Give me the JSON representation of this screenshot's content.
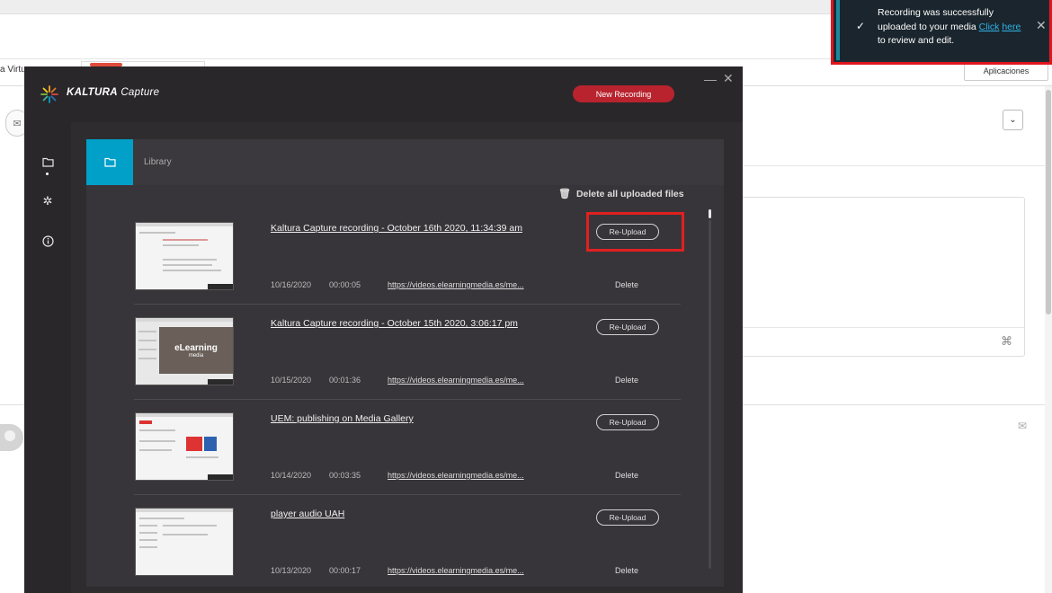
{
  "background": {
    "tab_text": "a Virtu",
    "apps_button": "Aplicaciones"
  },
  "app": {
    "brand": "KALTURA",
    "brand_sub": "Capture",
    "new_recording": "New Recording",
    "library_label": "Library",
    "delete_all": "Delete all uploaded files"
  },
  "icons": {
    "logo": "kaltura-logo-icon",
    "folder": "folder-icon",
    "settings": "gear-icon",
    "info": "info-icon",
    "trash": "trash-icon",
    "minimize": "minimize-icon",
    "close": "close-icon",
    "check": "check-icon"
  },
  "recordings": [
    {
      "title": "Kaltura Capture recording - October 16th 2020, 11:34:39 am",
      "date": "10/16/2020",
      "duration": "00:00:05",
      "url": "https://videos.elearningmedia.es/me...",
      "reupload": "Re-Upload",
      "delete": "Delete"
    },
    {
      "title": "Kaltura Capture recording - October 15th 2020, 3:06:17 pm",
      "date": "10/15/2020",
      "duration": "00:01:36",
      "url": "https://videos.elearningmedia.es/me...",
      "reupload": "Re-Upload",
      "delete": "Delete",
      "thumb_text": "eLearning",
      "thumb_sub": "media"
    },
    {
      "title": "UEM: publishing on Media Gallery",
      "date": "10/14/2020",
      "duration": "00:03:35",
      "url": "https://videos.elearningmedia.es/me...",
      "reupload": "Re-Upload",
      "delete": "Delete"
    },
    {
      "title": "player audio UAH",
      "date": "10/13/2020",
      "duration": "00:00:17",
      "url": "https://videos.elearningmedia.es/me...",
      "reupload": "Re-Upload",
      "delete": "Delete"
    }
  ],
  "toast": {
    "text_before": "Recording was successfully uploaded to your media",
    "link_part1": "Click",
    "link_part2": "here",
    "text_after": "to review and edit."
  },
  "colors": {
    "accent_blue": "#00a0c8",
    "record_red": "#b8232e",
    "highlight_red": "#e02020",
    "toast_link": "#31b4e6"
  }
}
